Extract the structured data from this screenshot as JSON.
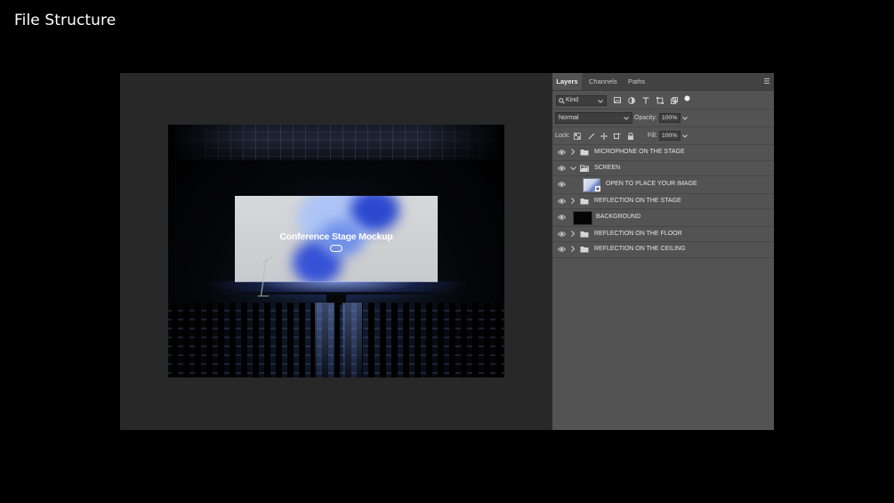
{
  "page_title": "File Structure",
  "canvas": {
    "screen_title": "Conference Stage Mockup"
  },
  "panel": {
    "tabs": [
      {
        "label": "Layers",
        "active": true
      },
      {
        "label": "Channels",
        "active": false
      },
      {
        "label": "Paths",
        "active": false
      }
    ],
    "filter": {
      "kind_label": "Kind",
      "filter_icons": [
        "image-filter-icon",
        "adjustment-filter-icon",
        "type-filter-icon",
        "shape-filter-icon",
        "smart-object-filter-icon"
      ]
    },
    "blend_mode": "Normal",
    "opacity_label": "Opacity:",
    "opacity_value": "100%",
    "lock_label": "Lock:",
    "lock_icons": [
      "lock-transparent-icon",
      "lock-paint-icon",
      "lock-position-icon",
      "lock-artboard-icon",
      "lock-all-icon"
    ],
    "fill_label": "Fill:",
    "fill_value": "100%",
    "layers": [
      {
        "name": "MICROPHONE ON THE STAGE",
        "type": "group",
        "expanded": false,
        "visible": true
      },
      {
        "name": "SCREEN",
        "type": "group",
        "expanded": true,
        "visible": true
      },
      {
        "name": "OPEN TO PLACE YOUR IMAGE",
        "type": "smart-object",
        "visible": true
      },
      {
        "name": "REFLECTION ON THE STAGE",
        "type": "group",
        "expanded": false,
        "visible": true
      },
      {
        "name": "BACKGROUND",
        "type": "pixel",
        "visible": true
      },
      {
        "name": "REFLECTION ON THE FLOOR",
        "type": "group",
        "expanded": false,
        "visible": true
      },
      {
        "name": "REFLECTION ON THE CEILING",
        "type": "group",
        "expanded": false,
        "visible": true
      }
    ]
  },
  "colors": {
    "app_bg": "#282828",
    "panel_bg": "#535353",
    "accent_blue": "#2f4fd8"
  }
}
